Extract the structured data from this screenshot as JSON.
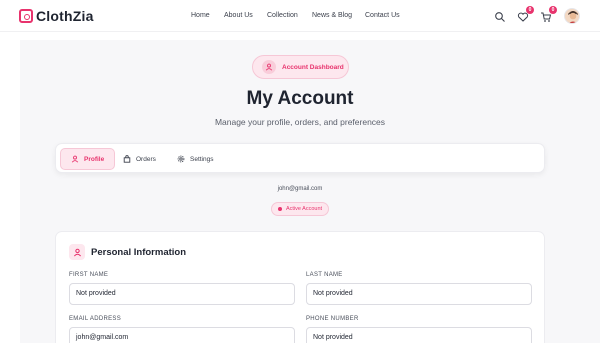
{
  "header": {
    "brand": "ClothZia",
    "nav": [
      "Home",
      "About Us",
      "Collection",
      "News & Blog",
      "Contact Us"
    ],
    "wishlist_count": "0",
    "cart_count": "0"
  },
  "hero": {
    "badge": "Account Dashboard",
    "title": "My Account",
    "subtitle": "Manage your profile, orders, and preferences"
  },
  "tabs": [
    {
      "label": "Profile",
      "icon": "user-icon",
      "active": true
    },
    {
      "label": "Orders",
      "icon": "bag-icon",
      "active": false
    },
    {
      "label": "Settings",
      "icon": "gear-icon",
      "active": false
    }
  ],
  "account": {
    "email": "john@gmail.com",
    "status": "Active Account"
  },
  "personal_info": {
    "title": "Personal Information",
    "fields": [
      {
        "label": "FIRST NAME",
        "value": "Not provided"
      },
      {
        "label": "LAST NAME",
        "value": "Not provided"
      },
      {
        "label": "EMAIL ADDRESS",
        "value": "john@gmail.com"
      },
      {
        "label": "PHONE NUMBER",
        "value": "Not provided"
      }
    ]
  },
  "colors": {
    "accent": "#e8336d",
    "accent_soft": "#fde7ee",
    "page_bg": "#f7f7f9"
  }
}
